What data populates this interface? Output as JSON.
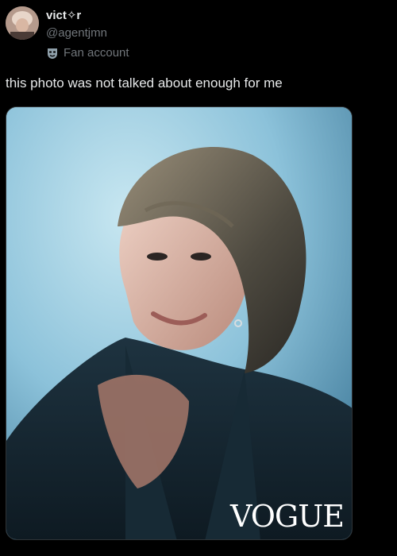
{
  "author": {
    "display_name": "vict✧r",
    "handle": "@agentjmn",
    "label": "Fan account",
    "avatar_icon": "profile-avatar",
    "label_icon": "theater-mask-icon"
  },
  "tweet": {
    "text": "this photo was not talked about enough for me"
  },
  "media": {
    "magazine_logo": "VOGUE",
    "kind": "photo"
  },
  "colors": {
    "background": "#000000",
    "primary_text": "#e7e9ea",
    "secondary_text": "#71767b",
    "border": "#2f3336"
  }
}
